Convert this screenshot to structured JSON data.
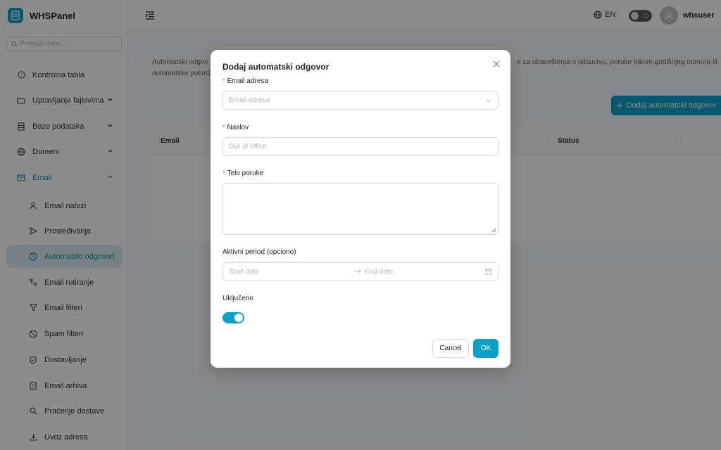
{
  "brand": {
    "name": "WHSPanel"
  },
  "sidebar": {
    "search_placeholder": "Pretraži meni...",
    "items": [
      {
        "label": "Kontrolna tabla",
        "icon": "dashboard-icon"
      },
      {
        "label": "Upravljanje fajlovima",
        "icon": "folder-icon"
      },
      {
        "label": "Baze podataka",
        "icon": "database-icon"
      },
      {
        "label": "Domeni",
        "icon": "globe-icon"
      },
      {
        "label": "Email",
        "icon": "mail-icon"
      },
      {
        "label": "Email nalozi",
        "icon": "user-icon"
      },
      {
        "label": "Prosleđivanja",
        "icon": "send-icon"
      },
      {
        "label": "Automatski odgovori",
        "icon": "clock-icon"
      },
      {
        "label": "Email rutiranje",
        "icon": "route-icon"
      },
      {
        "label": "Email filteri",
        "icon": "filter-icon"
      },
      {
        "label": "Spam filteri",
        "icon": "block-icon"
      },
      {
        "label": "Dostavljanje",
        "icon": "shield-icon"
      },
      {
        "label": "Email arhiva",
        "icon": "archive-icon"
      },
      {
        "label": "Praćenje dostave",
        "icon": "search-icon"
      },
      {
        "label": "Uvoz adresa",
        "icon": "import-icon"
      }
    ]
  },
  "header": {
    "language": "EN",
    "username": "whsuser"
  },
  "main": {
    "description_left_1": "Automatski odgov",
    "description_left_2": "automatske potvrd",
    "description_right": "e za obaveštenja o odsustvu, poruke tokom godišnjeg odmora ili",
    "add_button": "Dodaj automatski odgovor",
    "table": {
      "col_email": "Email",
      "col_status": "Status"
    }
  },
  "modal": {
    "title": "Dodaj automatski odgovor",
    "email_label": "Email adresa",
    "email_placeholder": "Email adresa",
    "subject_label": "Naslov",
    "subject_placeholder": "Out of office",
    "body_label": "Telo poruke",
    "period_label": "Aktivni period (opciono)",
    "start_placeholder": "Start date",
    "end_placeholder": "End date",
    "enabled_label": "Uključeno",
    "enabled": true,
    "cancel": "Cancel",
    "ok": "OK"
  },
  "colors": {
    "accent": "#0aa0c8",
    "required": "#ff4d4f"
  }
}
